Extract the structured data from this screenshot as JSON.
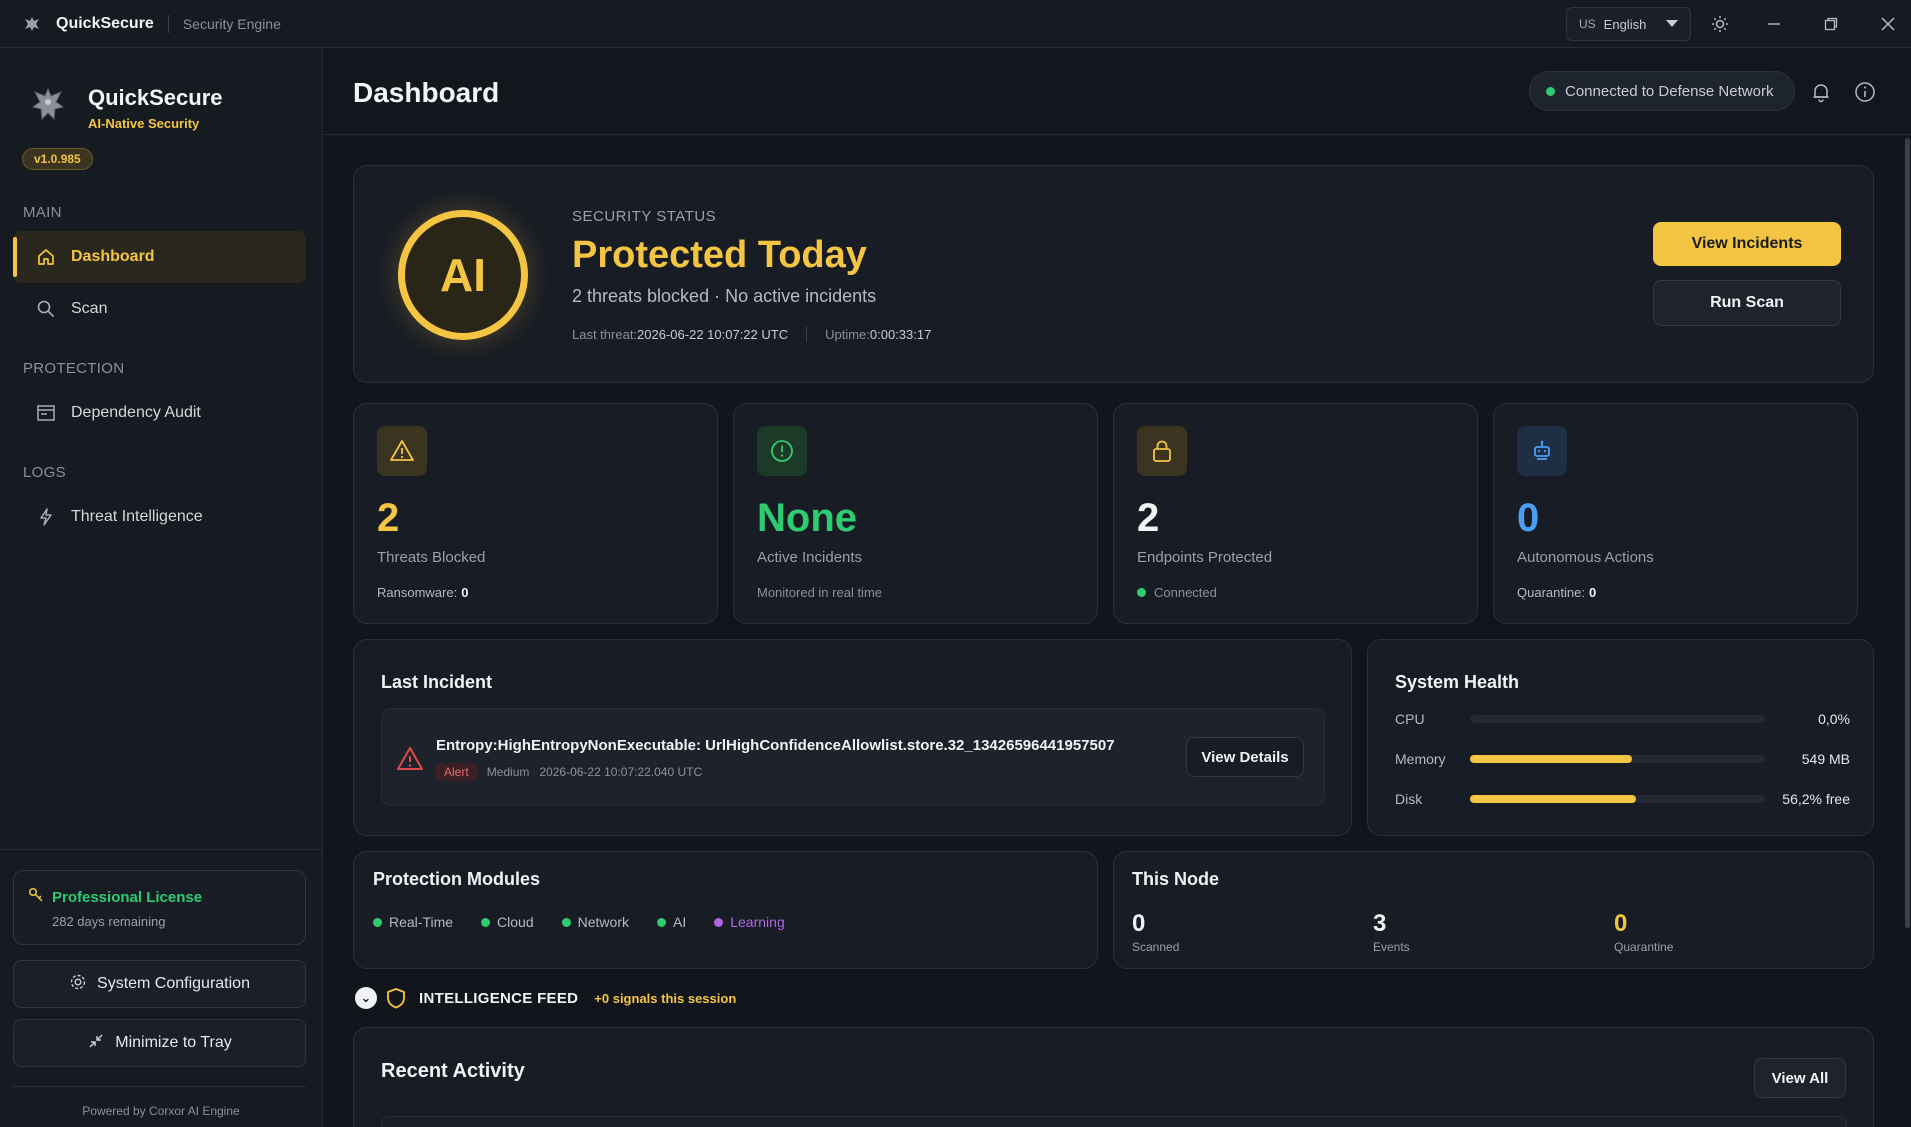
{
  "titlebar": {
    "app_name": "QuickSecure",
    "subtitle": "Security Engine",
    "language_flag": "US",
    "language": "English"
  },
  "sidebar": {
    "brand_name": "QuickSecure",
    "brand_tagline": "AI-Native Security",
    "version": "v1.0.985",
    "sections": {
      "main": "MAIN",
      "protection": "PROTECTION",
      "logs": "LOGS"
    },
    "items": [
      {
        "label": "Dashboard",
        "icon": "home-icon",
        "active": true
      },
      {
        "label": "Scan",
        "icon": "search-icon",
        "active": false
      },
      {
        "label": "Dependency Audit",
        "icon": "audit-icon",
        "active": false
      },
      {
        "label": "Threat Intelligence",
        "icon": "lightning-icon",
        "active": false
      }
    ],
    "license": {
      "title": "Professional License",
      "remaining": "282 days remaining"
    },
    "system_config_label": "System Configuration",
    "minimize_label": "Minimize to Tray",
    "powered_by": "Powered by Corxor AI Engine"
  },
  "header": {
    "title": "Dashboard",
    "network_status": "Connected to Defense Network"
  },
  "hero": {
    "badge": "AI",
    "eyebrow": "SECURITY STATUS",
    "headline": "Protected Today",
    "summary": "2 threats blocked · No active incidents",
    "last_threat_label": "Last threat:",
    "last_threat_value": "2026-06-22 10:07:22 UTC",
    "uptime_label": "Uptime:",
    "uptime_value": "0:00:33:17",
    "view_incidents_label": "View Incidents",
    "run_scan_label": "Run Scan"
  },
  "stats": [
    {
      "value": "2",
      "label": "Threats Blocked",
      "sub_label": "Ransomware:",
      "sub_value": "0",
      "color": "#f4c542",
      "icon": "warning-icon"
    },
    {
      "value": "None",
      "label": "Active Incidents",
      "sub_label": "Monitored in real time",
      "sub_value": "",
      "color": "#2ecc71",
      "icon": "alert-circle-icon"
    },
    {
      "value": "2",
      "label": "Endpoints Protected",
      "sub_label": "Connected",
      "sub_value": "",
      "color": "#f1f2f4",
      "icon": "lock-icon"
    },
    {
      "value": "0",
      "label": "Autonomous Actions",
      "sub_label": "Quarantine:",
      "sub_value": "0",
      "color": "#4a9ff5",
      "icon": "robot-icon"
    }
  ],
  "last_incident": {
    "title": "Last Incident",
    "name": "Entropy:HighEntropyNonExecutable: UrlHighConfidenceAllowlist.store.32_13426596441957507",
    "type": "Alert",
    "severity": "Medium",
    "timestamp": "2026-06-22 10:07:22.040 UTC",
    "details_label": "View Details"
  },
  "system_health": {
    "title": "System Health",
    "rows": [
      {
        "label": "CPU",
        "value": "0,0%",
        "fill_percent": 0
      },
      {
        "label": "Memory",
        "value": "549 MB",
        "fill_percent": 55
      },
      {
        "label": "Disk",
        "value": "56,2% free",
        "fill_percent": 56.2
      }
    ]
  },
  "protection_modules": {
    "title": "Protection Modules",
    "modules": [
      {
        "label": "Real-Time",
        "color": "#2ecc71"
      },
      {
        "label": "Cloud",
        "color": "#2ecc71"
      },
      {
        "label": "Network",
        "color": "#2ecc71"
      },
      {
        "label": "AI",
        "color": "#2ecc71"
      },
      {
        "label": "Learning",
        "color": "#b366e0"
      }
    ]
  },
  "this_node": {
    "title": "This Node",
    "stats": [
      {
        "value": "0",
        "label": "Scanned"
      },
      {
        "value": "3",
        "label": "Events"
      },
      {
        "value": "0",
        "label": "Quarantine"
      }
    ]
  },
  "intelligence_feed": {
    "title": "INTELLIGENCE FEED",
    "signals": "+0 signals this session"
  },
  "recent_activity": {
    "title": "Recent Activity",
    "view_all_label": "View All"
  },
  "colors": {
    "accent": "#f4c542",
    "success": "#2ecc71",
    "danger": "#e04848",
    "info": "#4a9ff5",
    "purple": "#b366e0"
  }
}
